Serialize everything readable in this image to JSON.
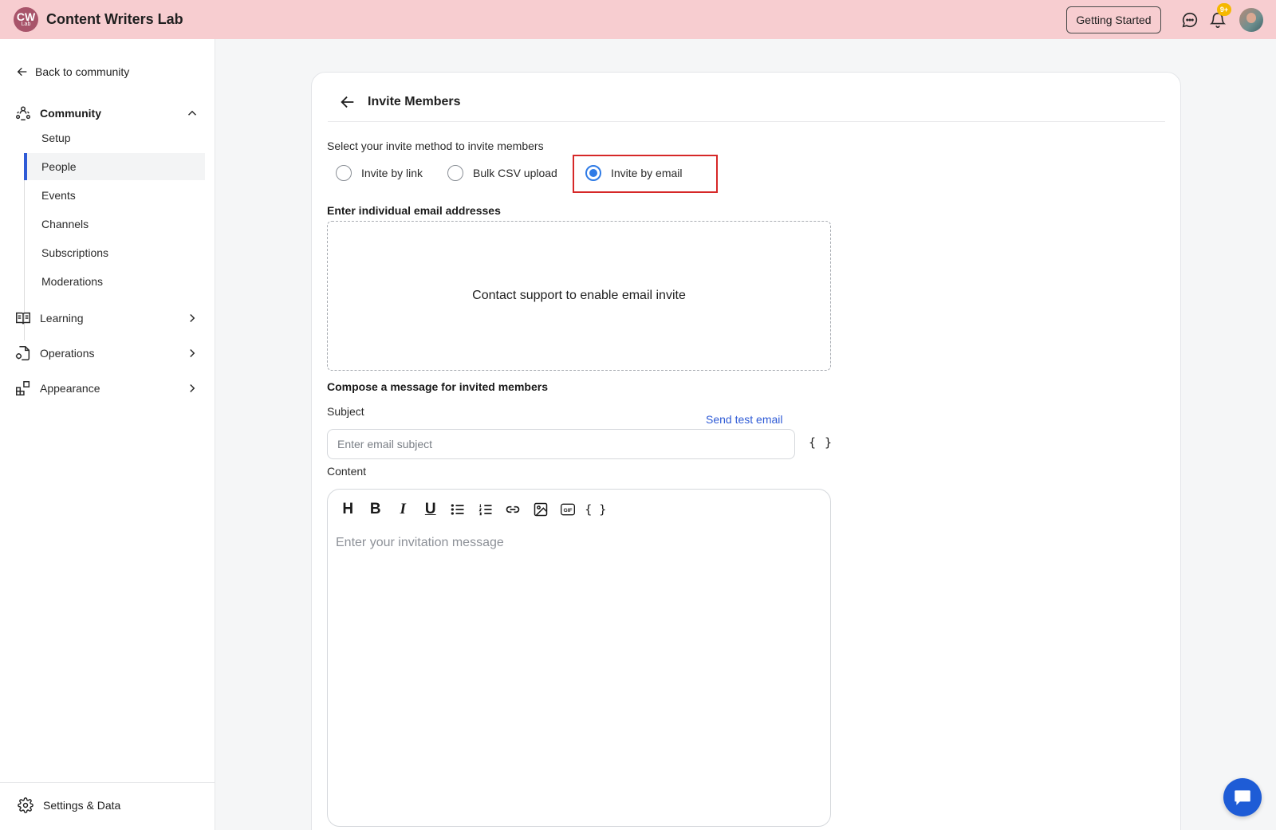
{
  "topbar": {
    "logo_line1": "CW",
    "logo_line2": "Lab",
    "brand_name": "Content Writers Lab",
    "getting_started_label": "Getting Started",
    "notification_badge": "9+"
  },
  "sidebar": {
    "back_label": "Back to community",
    "sections": {
      "community": "Community",
      "learning": "Learning",
      "operations": "Operations",
      "appearance": "Appearance"
    },
    "community_items": [
      "Setup",
      "People",
      "Events",
      "Channels",
      "Subscriptions",
      "Moderations"
    ],
    "active_item": "People",
    "settings_label": "Settings & Data"
  },
  "main": {
    "title": "Invite Members",
    "method_prompt": "Select your invite method to invite members",
    "methods": [
      {
        "label": "Invite by link",
        "selected": false
      },
      {
        "label": "Bulk CSV upload",
        "selected": false
      },
      {
        "label": "Invite by email",
        "selected": true
      }
    ],
    "email_section_label": "Enter individual email addresses",
    "email_disabled_message": "Contact support to enable email invite",
    "compose_label": "Compose a message for invited members",
    "subject_label": "Subject",
    "send_test_label": "Send test email",
    "subject_placeholder": "Enter email subject",
    "variables_label": "{ }",
    "content_label": "Content",
    "toolbar": {
      "heading": "H",
      "bold": "B",
      "italic": "I",
      "underline": "U",
      "gif": "GIF",
      "variables": "{ }"
    },
    "content_placeholder": "Enter your invitation message"
  },
  "colors": {
    "topbar_bg": "#f7cdd0",
    "accent_blue": "#2f5bd6",
    "radio_blue": "#2f7be6",
    "highlight_red": "#d62828",
    "badge_yellow": "#f5b800"
  },
  "icons": {
    "messages": "chat-bubble-icon",
    "notifications": "bell-icon",
    "chat_fab": "chat-icon"
  }
}
